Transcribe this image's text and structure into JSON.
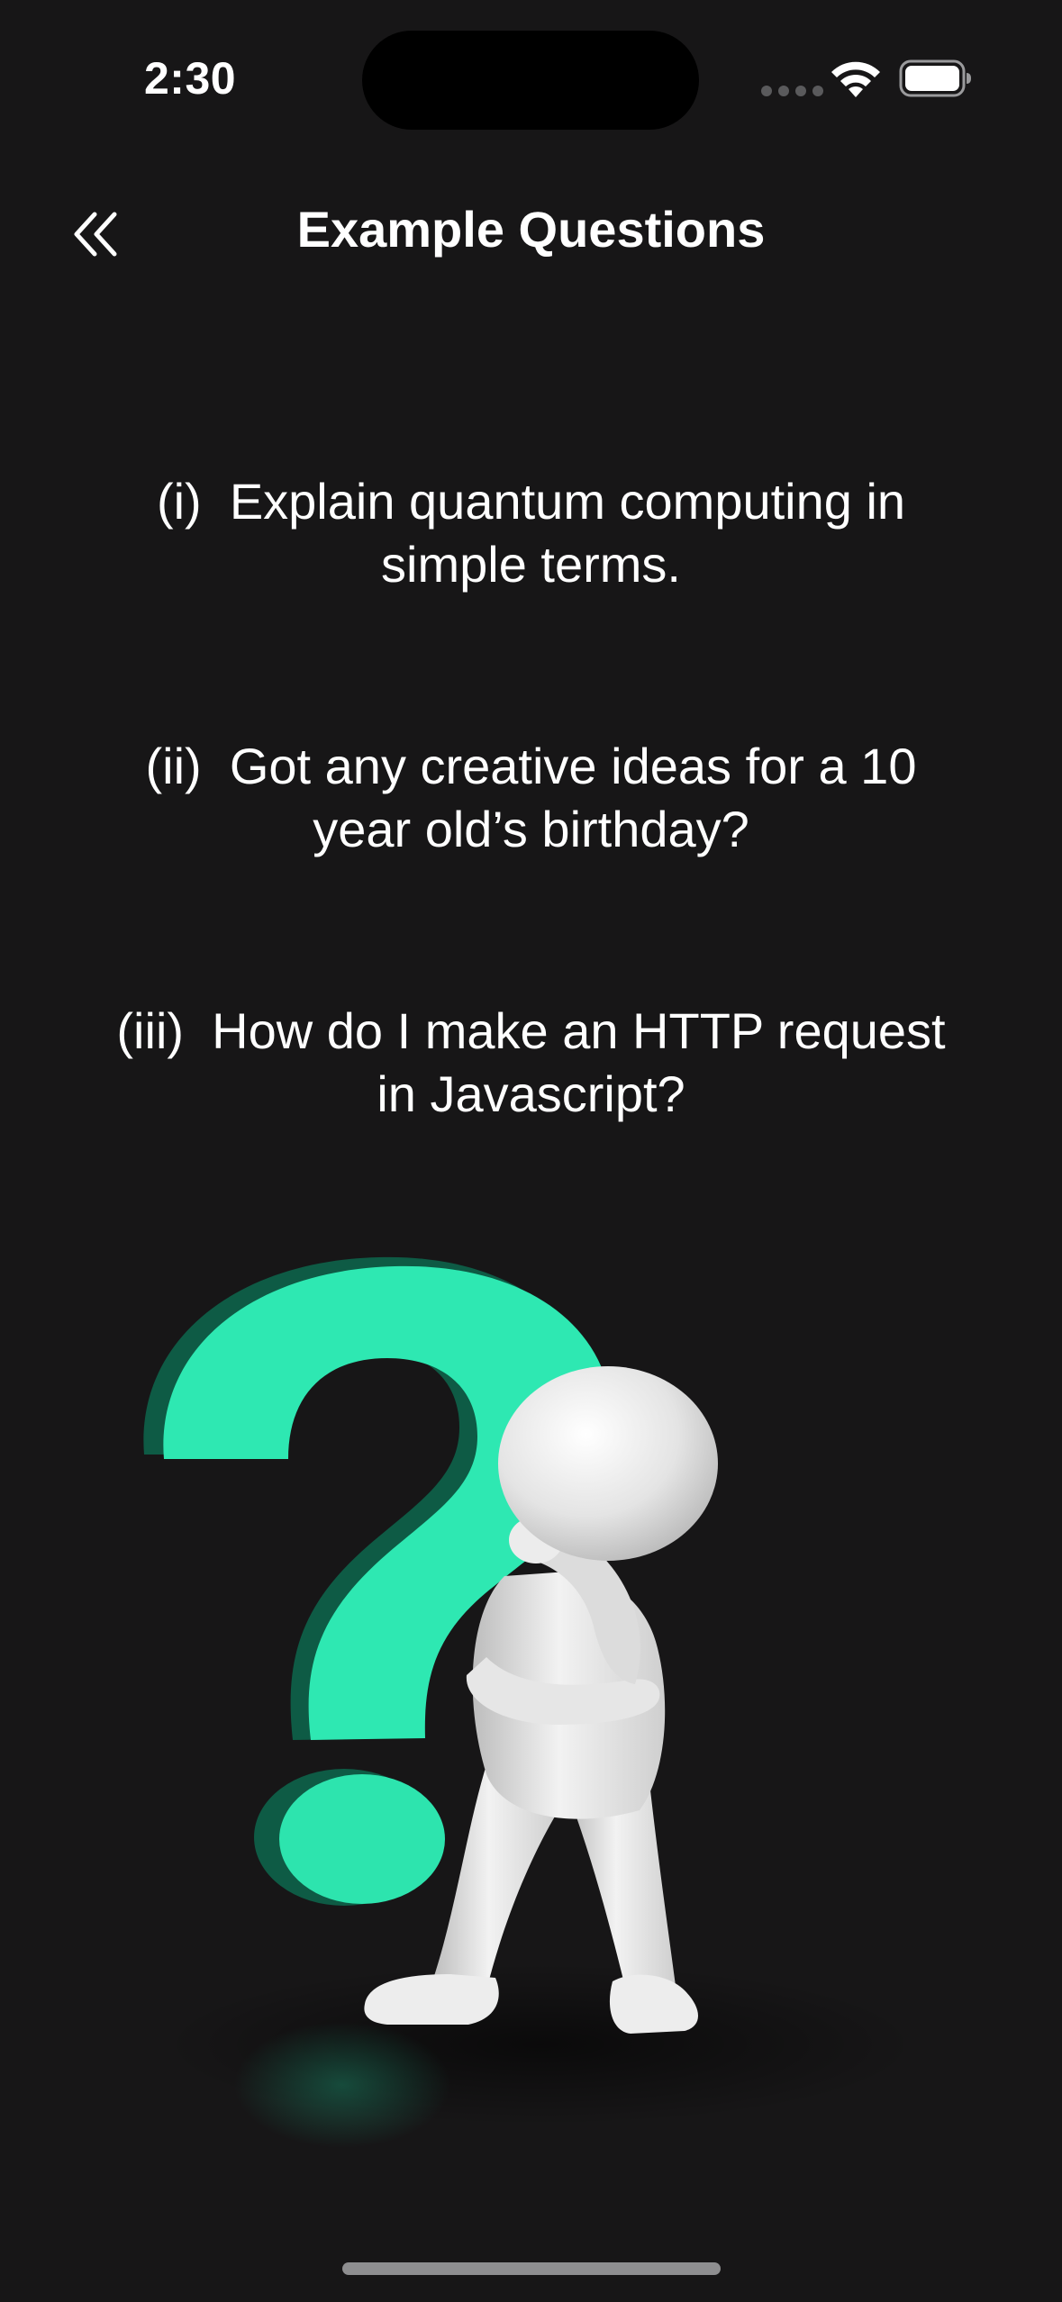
{
  "status_bar": {
    "time": "2:30"
  },
  "nav": {
    "title": "Example Questions",
    "back_icon": "double-chevron-left-icon"
  },
  "questions": [
    {
      "marker": "(i)",
      "text": "Explain quantum computing in simple terms."
    },
    {
      "marker": "(ii)",
      "text": "Got any creative ideas for a 10 year old’s birthday?"
    },
    {
      "marker": "(iii)",
      "text": "How do I make an HTTP request in Javascript?"
    }
  ],
  "colors": {
    "background": "#171617",
    "question_mark": "#2ee8b2",
    "question_mark_shadow": "#0f5a44",
    "figure": "#e9e9e9",
    "text": "#ffffff"
  },
  "illustration": {
    "subject": "thinking-figure-with-question-mark"
  }
}
